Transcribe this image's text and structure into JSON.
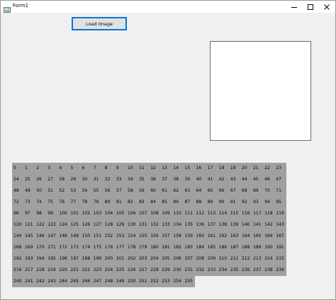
{
  "window": {
    "title": "Form1",
    "controls": {
      "minimize_icon": "minimize-icon",
      "maximize_icon": "maximize-icon",
      "close_icon": "close-icon"
    }
  },
  "load_button": {
    "label": "Load Image"
  },
  "picture_box": {
    "content": ""
  },
  "grid": {
    "columns": 24,
    "background_color": "#a0a0a0",
    "values": [
      "0",
      "1",
      "2",
      "3",
      "4",
      "5",
      "6",
      "7",
      "8",
      "9",
      "10",
      "11",
      "12",
      "13",
      "14",
      "15",
      "16",
      "17",
      "18",
      "19",
      "20",
      "21",
      "22",
      "23",
      "24",
      "25",
      "26",
      "27",
      "28",
      "29",
      "30",
      "31",
      "32",
      "33",
      "34",
      "35",
      "36",
      "37",
      "38",
      "39",
      "40",
      "41",
      "42",
      "43",
      "44",
      "45",
      "46",
      "47",
      "48",
      "49",
      "50",
      "51",
      "52",
      "53",
      "54",
      "55",
      "56",
      "57",
      "58",
      "59",
      "60",
      "61",
      "62",
      "63",
      "64",
      "65",
      "66",
      "67",
      "68",
      "69",
      "70",
      "71",
      "72",
      "73",
      "74",
      "75",
      "76",
      "77",
      "78",
      "79",
      "80",
      "81",
      "82",
      "83",
      "84",
      "85",
      "86",
      "87",
      "88",
      "89",
      "90",
      "91",
      "92",
      "93",
      "94",
      "95",
      "96",
      "97",
      "98",
      "99",
      "100",
      "101",
      "102",
      "103",
      "104",
      "105",
      "106",
      "107",
      "108",
      "109",
      "110",
      "111",
      "112",
      "113",
      "114",
      "115",
      "116",
      "117",
      "118",
      "119",
      "120",
      "121",
      "122",
      "123",
      "124",
      "125",
      "126",
      "127",
      "128",
      "129",
      "130",
      "131",
      "132",
      "133",
      "134",
      "135",
      "136",
      "137",
      "138",
      "139",
      "140",
      "141",
      "142",
      "143",
      "144",
      "145",
      "146",
      "147",
      "148",
      "149",
      "150",
      "151",
      "152",
      "153",
      "154",
      "155",
      "156",
      "157",
      "158",
      "159",
      "160",
      "161",
      "162",
      "163",
      "164",
      "165",
      "166",
      "167",
      "168",
      "169",
      "170",
      "171",
      "172",
      "173",
      "174",
      "175",
      "176",
      "177",
      "178",
      "179",
      "180",
      "181",
      "182",
      "183",
      "184",
      "185",
      "186",
      "187",
      "188",
      "189",
      "190",
      "191",
      "192",
      "193",
      "194",
      "195",
      "196",
      "197",
      "198",
      "199",
      "200",
      "201",
      "202",
      "203",
      "204",
      "205",
      "206",
      "207",
      "208",
      "209",
      "210",
      "211",
      "212",
      "213",
      "214",
      "215",
      "216",
      "217",
      "218",
      "219",
      "220",
      "221",
      "222",
      "223",
      "224",
      "225",
      "226",
      "227",
      "228",
      "229",
      "230",
      "231",
      "232",
      "233",
      "234",
      "235",
      "236",
      "237",
      "238",
      "239",
      "240",
      "241",
      "242",
      "243",
      "244",
      "245",
      "246",
      "247",
      "248",
      "249",
      "250",
      "251",
      "252",
      "253",
      "254",
      "255"
    ]
  }
}
